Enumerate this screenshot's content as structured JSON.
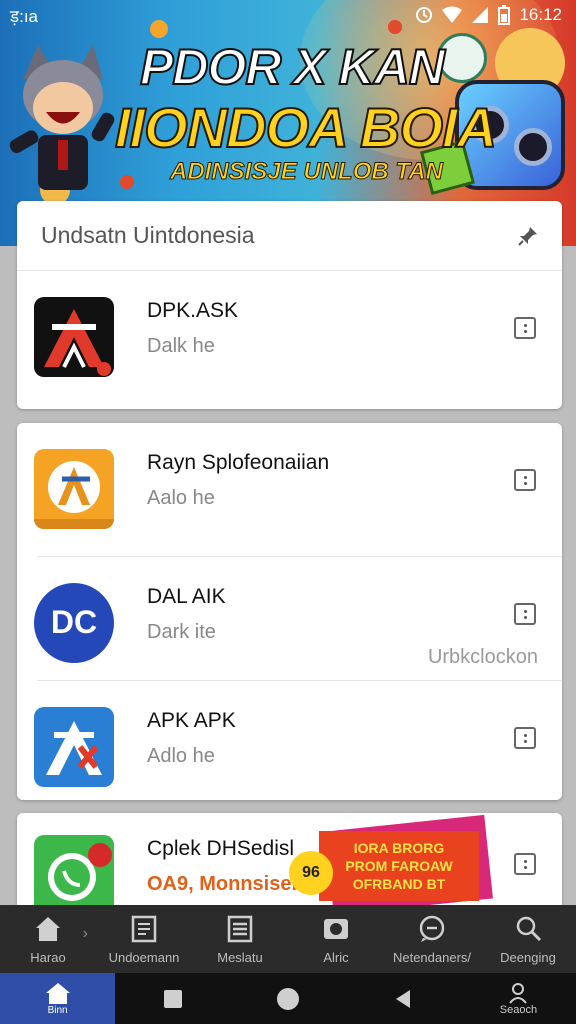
{
  "status_bar": {
    "left_text": "ड़:ıa",
    "time": "16:12"
  },
  "banner": {
    "line1": "PDOR X KAN",
    "line2": "IIONDOA BOIA",
    "line3": "ADINSISJE UNLOB TAN"
  },
  "card1": {
    "title": "Undsatn Uintdonesia",
    "apps": [
      {
        "name": "DPK.ASK",
        "sub": "Dalk he",
        "icon": "apk-a-red-icon"
      }
    ]
  },
  "card2": {
    "apps": [
      {
        "name": "Rayn Splofeonaiian",
        "sub": "Aalo he",
        "icon": "apk-a-orange-icon"
      },
      {
        "name": "DAL AIK",
        "sub": "Dark ite",
        "icon": "dc-icon",
        "action": "Urbkclockon"
      },
      {
        "name": "APK APK",
        "sub": "Adlo he",
        "icon": "apk-a-blue-icon"
      }
    ]
  },
  "card3": {
    "apps": [
      {
        "name": "Cplek DHSedisl",
        "sub": "OA9, Monnsisel",
        "icon": "whatsapp-icon"
      }
    ],
    "promo": {
      "line1": "IORA BRORG",
      "line2": "PROM FAROAW",
      "line3": "OFRBAND BT",
      "badge": "96"
    }
  },
  "bottom_nav": [
    {
      "label": "Harao",
      "icon": "home-icon"
    },
    {
      "label": "Undoemann",
      "icon": "document-icon"
    },
    {
      "label": "Meslatu",
      "icon": "list-icon"
    },
    {
      "label": "Alric",
      "icon": "play-icon"
    },
    {
      "label": "Netendaners/",
      "icon": "chat-icon"
    },
    {
      "label": "Deenging",
      "icon": "search-icon"
    }
  ],
  "sys_nav": {
    "home_label": "Binn",
    "search_label": "Seaoch"
  },
  "colors": {
    "accent": "#2f4ea8",
    "nav_bg": "#2b2b2b",
    "sys_bg": "#111111"
  }
}
